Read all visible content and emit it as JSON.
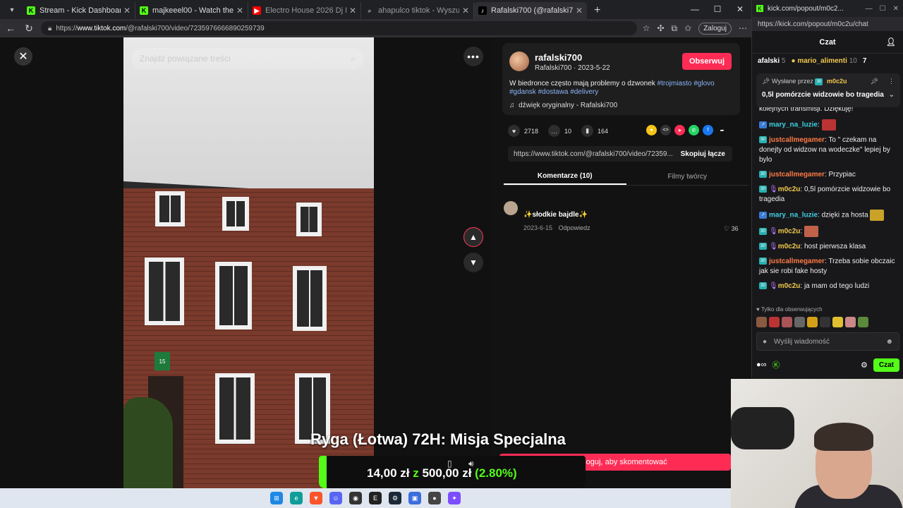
{
  "browser": {
    "tabs": [
      {
        "title": "Stream - Kick Dashboard",
        "favicon": "kick-icon",
        "color": "#53fc18",
        "active": false
      },
      {
        "title": "majkeeel00 - Watch the VOD on K",
        "favicon": "kick-icon",
        "color": "#53fc18",
        "active": false
      },
      {
        "title": "Electro House 2026 Dj Remix",
        "favicon": "youtube-icon",
        "color": "#ff0000",
        "active": false
      },
      {
        "title": "ahapulco tiktok - Wyszukaj",
        "favicon": "search-icon",
        "color": "#888888",
        "active": false
      },
      {
        "title": "Rafalski700 (@rafalski700) | Ti",
        "favicon": "tiktok-icon",
        "color": "#000000",
        "active": true
      }
    ],
    "url_prefix": "https://",
    "url_domain": "www.tiktok.com",
    "url_path": "/@rafalski700/video/7235976666890259739",
    "login_label": "Zaloguj"
  },
  "tiktok": {
    "search_placeholder": "Znajdź powiązane treści",
    "username": "rafalski700",
    "subline": "Rafalski700 · 2023-5-22",
    "follow_label": "Obserwuj",
    "description": "W biedronce często mają problemy o dzwonek",
    "hashtags": [
      "#trojmiasto",
      "#glovo",
      "#gdansk",
      "#dostawa",
      "#delivery"
    ],
    "music": "dźwięk oryginalny - Rafalski700",
    "likes": "2718",
    "comments": "10",
    "saves": "164",
    "link": "https://www.tiktok.com/@rafalski700/video/72359...",
    "copy_label": "Skopiuj łącze",
    "tab_comments": "Komentarze (10)",
    "tab_creator": "Filmy twórcy",
    "comment": {
      "text": "✨słodkie bajdle✨",
      "date": "2023-6-15",
      "reply": "Odpowiedz",
      "likes": "36"
    },
    "house_number": "15"
  },
  "overlay": {
    "title": "Ryga (Łotwa) 72H: Misja Specjalna",
    "amount_current": "14,00 zł",
    "amount_sep": "z",
    "amount_goal": "500,00 zł",
    "percent": "(2.80%)",
    "progress": 0.028,
    "comment_btn": "Zaloguj, aby skomentować"
  },
  "kick": {
    "tab_title": "kick.com/popout/m0c2...",
    "url": "https://kick.com/popout/m0c2u/chat",
    "header": "Czat",
    "gifters": [
      {
        "name": "afalski",
        "count": "5"
      },
      {
        "name": "mario_alimenti",
        "count": "10"
      },
      {
        "name": "7",
        "count": ""
      }
    ],
    "pinned_by_label": "Wysłane przez",
    "pinned_by": "m0c2u",
    "pinned_msg": "0,5l pomórzcie widzowie bo tragedia",
    "messages": [
      {
        "user": "",
        "text": "kolejnych transmisji. Dziękuję!"
      },
      {
        "user": "mary_na_luzie",
        "text": ""
      },
      {
        "user": "justcallmegamer",
        "text": "To \" czekam na donejty od widzow na wodeczke\" lepiej by bylo"
      },
      {
        "user": "justcallmegamer",
        "text": "Przypiac"
      },
      {
        "user": "m0c2u",
        "text": "0,5l pomórzcie widzowie bo tragedia"
      },
      {
        "user": "mary_na_luzie",
        "text": "dzięki za hosta"
      },
      {
        "user": "m0c2u",
        "text": ""
      },
      {
        "user": "m0c2u",
        "text": "host pierwsza klasa"
      },
      {
        "user": "justcallmegamer",
        "text": "Trzeba sobie obczaic jak sie robi fake hosty"
      },
      {
        "user": "m0c2u",
        "text": "ja mam od tego ludzi"
      }
    ],
    "followers_only": "Tylko dla obserwujących",
    "input_placeholder": "Wyślij wiadomość",
    "chat_btn": "Czat"
  }
}
